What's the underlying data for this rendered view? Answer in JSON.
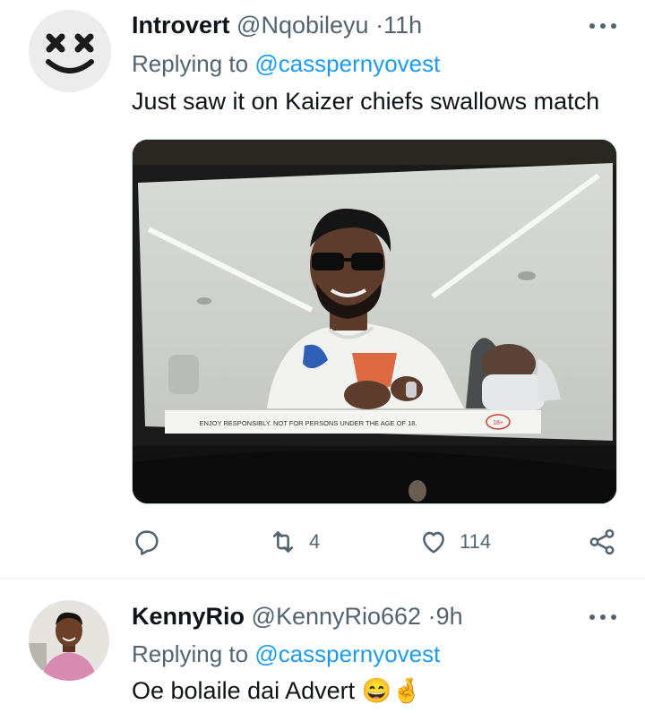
{
  "tweets": [
    {
      "name": "Introvert",
      "handle": "@Nqobileyu",
      "separator": "·",
      "time": "11h",
      "replying_prefix": "Replying to",
      "replying_to": "@casspernyovest",
      "text": "Just saw it on Kaizer chiefs swallows match",
      "media": {
        "overlay_text": "ENJOY RESPONSIBLY. NOT FOR PERSONS UNDER THE AGE OF 18.",
        "age_badge": "18+"
      },
      "actions": {
        "reply_icon": "reply-icon",
        "retweet_icon": "retweet-icon",
        "retweets": "4",
        "like_icon": "heart-icon",
        "likes": "114",
        "share_icon": "share-icon"
      }
    },
    {
      "name": "KennyRio",
      "handle": "@KennyRio662",
      "separator": "·",
      "time": "9h",
      "replying_prefix": "Replying to",
      "replying_to": "@casspernyovest",
      "text": "Oe bolaile dai Advert",
      "emojis": [
        "😄",
        "🤞"
      ]
    }
  ],
  "colors": {
    "text": "#0f1419",
    "secondary": "#536471",
    "link": "#1d9bf0",
    "divider": "#eff3f4"
  }
}
